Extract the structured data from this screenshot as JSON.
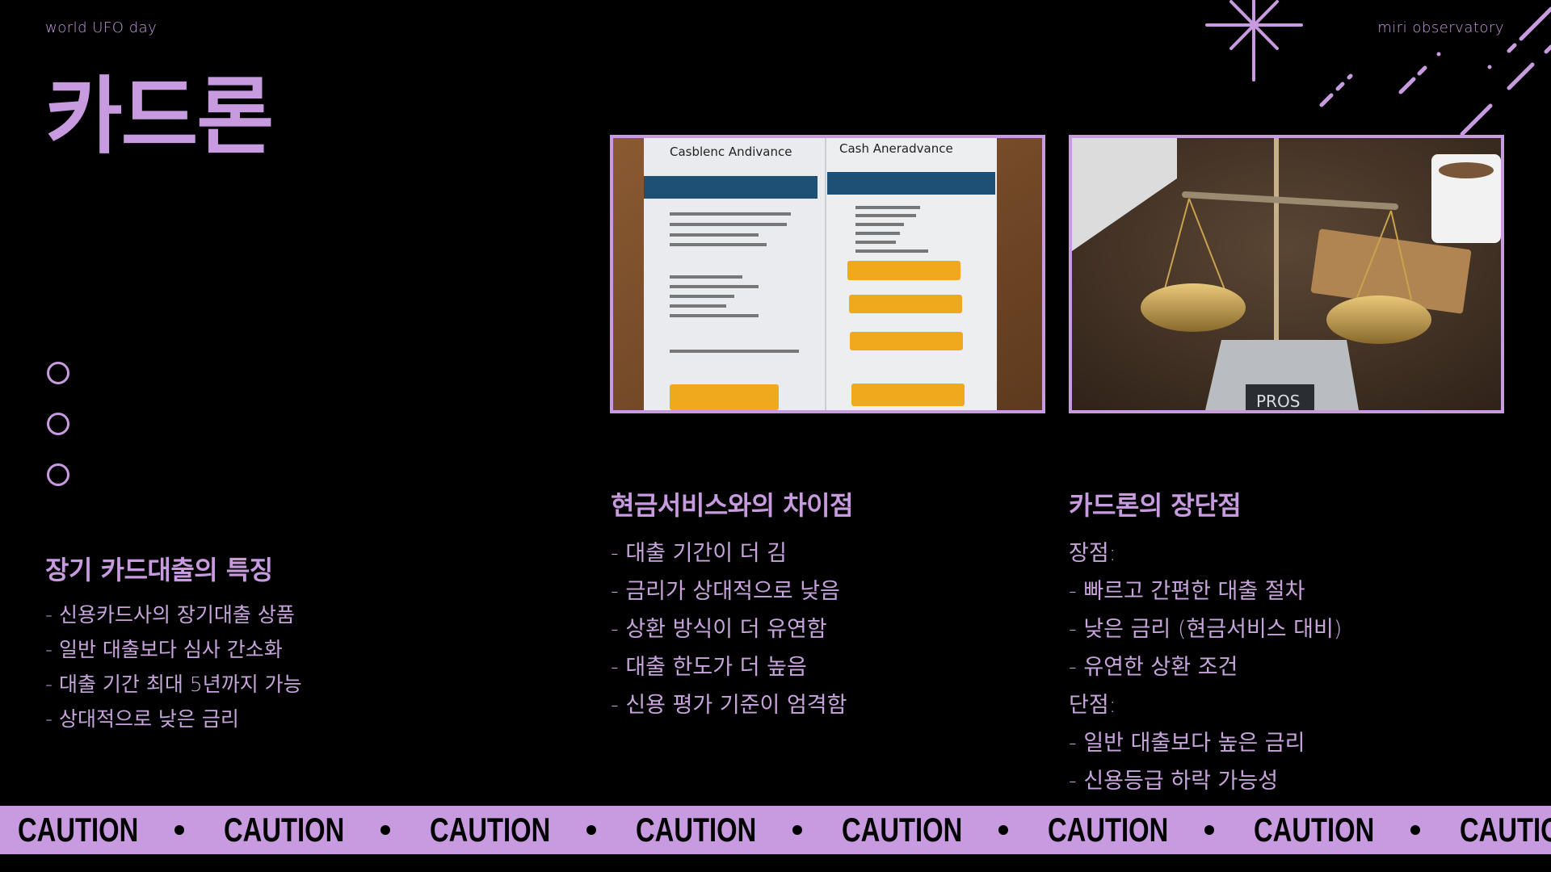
{
  "header": {
    "brand_left": "world UFO day",
    "brand_right": "miri observatory",
    "title": "카드론"
  },
  "decorations": {
    "accent_color": "#c89ae0",
    "background_color": "#000000",
    "star_icon": "sparkle-star",
    "ring_count": 3
  },
  "photos": [
    {
      "name": "cash-advance-document-photo",
      "description": "Printed document comparing card loan and cash advance with highlighted orange boxes",
      "visible_text": [
        "Casblenc Andivance",
        "Cash Aneradvance"
      ]
    },
    {
      "name": "balance-scale-photo",
      "description": "Brass balance scale on wooden desk with digital display reading PROS",
      "visible_text": [
        "PROS"
      ]
    }
  ],
  "sections": {
    "features": {
      "heading": "장기 카드대출의 특징",
      "items": [
        "- 신용카드사의 장기대출 상품",
        "- 일반 대출보다 심사 간소화",
        "- 대출 기간 최대 5년까지 가능",
        "- 상대적으로 낮은 금리"
      ]
    },
    "differences": {
      "heading": "현금서비스와의 차이점",
      "items": [
        "- 대출 기간이 더 김",
        "- 금리가 상대적으로 낮음",
        "- 상환 방식이 더 유연함",
        "- 대출 한도가 더 높음",
        "- 신용 평가 기준이 엄격함"
      ]
    },
    "pros_cons": {
      "heading": "카드론의 장단점",
      "items": [
        "장점:",
        "- 빠르고 간편한 대출 절차",
        "- 낮은 금리 (현금서비스 대비)",
        "- 유연한 상환 조건",
        "단점:",
        "- 일반 대출보다 높은 금리",
        "- 신용등급 하락 가능성"
      ]
    }
  },
  "caution_band": {
    "word": "CAUTION",
    "repeat": 9
  }
}
